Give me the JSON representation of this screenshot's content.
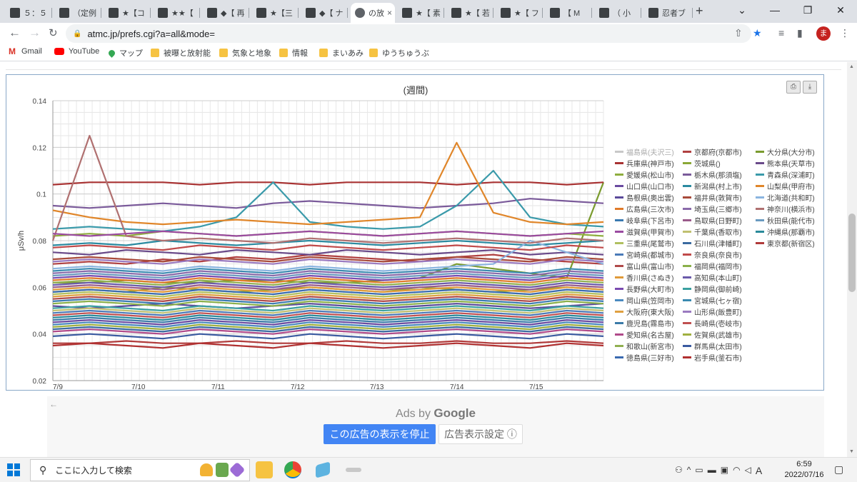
{
  "browser": {
    "tabs": [
      {
        "label": "５：５",
        "active": false
      },
      {
        "label": "（定例",
        "active": false
      },
      {
        "label": "★【コ",
        "active": false
      },
      {
        "label": "★★【",
        "active": false
      },
      {
        "label": "◆【 再",
        "active": false
      },
      {
        "label": "★【三",
        "active": false
      },
      {
        "label": "◆【 ナ",
        "active": false
      },
      {
        "label": "の放",
        "active": true
      },
      {
        "label": "★【 素",
        "active": false
      },
      {
        "label": "★【 若",
        "active": false
      },
      {
        "label": "★【 フ",
        "active": false
      },
      {
        "label": "【 M",
        "active": false
      },
      {
        "label": "（ 小",
        "active": false
      },
      {
        "label": "忍者ブ",
        "active": false
      }
    ],
    "new_tab": "+",
    "url": "atmc.jp/prefs.cgi?a=all&mode=",
    "profile_initial": "ま",
    "window_controls": [
      "⌄",
      "—",
      "❐",
      "✕"
    ]
  },
  "bookmarks": [
    {
      "label": "Gmail",
      "icon": "gmail-icon"
    },
    {
      "label": "YouTube",
      "icon": "youtube-icon"
    },
    {
      "label": "マップ",
      "icon": "maps-icon"
    },
    {
      "label": "被曝と放射能",
      "icon": "folder-icon"
    },
    {
      "label": "気象と地象",
      "icon": "folder-icon"
    },
    {
      "label": "情報",
      "icon": "folder-icon"
    },
    {
      "label": "まいあみ",
      "icon": "folder-icon"
    },
    {
      "label": "ゆうちゅうぶ",
      "icon": "folder-icon"
    }
  ],
  "chart_data": {
    "type": "line",
    "title": "(週間)",
    "ylabel": "μSv/h",
    "xlabel": "",
    "ylim": [
      0.02,
      0.14
    ],
    "yticks": [
      "0.14",
      "0.12",
      "0.1",
      "0.08",
      "0.06",
      "0.04",
      "0.02"
    ],
    "ytick_values": [
      0.14,
      0.12,
      0.1,
      0.08,
      0.06,
      0.04,
      0.02
    ],
    "xticks": [
      "7/9",
      "7/10",
      "7/11",
      "7/12",
      "7/13",
      "7/14",
      "7/15"
    ],
    "grid": true,
    "legend_position": "right",
    "series": [
      {
        "name": "福島県(夫沢三)",
        "color": "#c8c8c8",
        "values": []
      },
      {
        "name": "京都府(京都市)",
        "color": "#b04040",
        "values": [
          0.07,
          0.071,
          0.07,
          0.072,
          0.071,
          0.073,
          0.072,
          0.074,
          0.073,
          0.072,
          0.071,
          0.073,
          0.074,
          0.072,
          0.071,
          0.07
        ]
      },
      {
        "name": "大分県(大分市)",
        "color": "#7a9b2e",
        "values": [
          0.062,
          0.062,
          0.063,
          0.062,
          0.062,
          0.063,
          0.063,
          0.062,
          0.062,
          0.063,
          0.064,
          0.07,
          0.068,
          0.066,
          0.064,
          0.105
        ]
      },
      {
        "name": "兵庫県(神戸市)",
        "color": "#a83232",
        "values": [
          0.104,
          0.105,
          0.105,
          0.105,
          0.104,
          0.105,
          0.105,
          0.104,
          0.105,
          0.105,
          0.105,
          0.104,
          0.105,
          0.105,
          0.104,
          0.105
        ]
      },
      {
        "name": "茨城県()",
        "color": "#8aa836",
        "values": [
          0.058,
          0.059,
          0.058,
          0.06,
          0.059,
          0.058,
          0.059,
          0.06,
          0.059,
          0.058,
          0.06,
          0.059,
          0.058,
          0.059,
          0.06,
          0.059
        ]
      },
      {
        "name": "熊本県(天草市)",
        "color": "#6a4a8a",
        "values": [
          0.075,
          0.074,
          0.076,
          0.075,
          0.074,
          0.076,
          0.075,
          0.074,
          0.076,
          0.075,
          0.074,
          0.075,
          0.076,
          0.074,
          0.075,
          0.074
        ]
      },
      {
        "name": "愛媛県(松山市)",
        "color": "#8fae3e",
        "values": [
          0.082,
          0.083,
          0.082,
          0.084,
          0.083,
          0.082,
          0.083,
          0.084,
          0.083,
          0.082,
          0.083,
          0.084,
          0.083,
          0.082,
          0.083,
          0.082
        ]
      },
      {
        "name": "栃木県(那須塩)",
        "color": "#7a5a9a",
        "values": [
          0.095,
          0.094,
          0.095,
          0.096,
          0.095,
          0.094,
          0.096,
          0.097,
          0.096,
          0.095,
          0.094,
          0.095,
          0.096,
          0.098,
          0.097,
          0.096
        ]
      },
      {
        "name": "青森県(深浦町)",
        "color": "#3a9aaa",
        "values": [
          0.085,
          0.086,
          0.085,
          0.084,
          0.086,
          0.09,
          0.105,
          0.088,
          0.086,
          0.085,
          0.086,
          0.095,
          0.11,
          0.09,
          0.087,
          0.086
        ]
      },
      {
        "name": "山口県(山口市)",
        "color": "#6a4aa0",
        "values": [
          0.045,
          0.046,
          0.045,
          0.044,
          0.046,
          0.045,
          0.044,
          0.046,
          0.045,
          0.044,
          0.045,
          0.046,
          0.045,
          0.044,
          0.046,
          0.045
        ]
      },
      {
        "name": "新潟県(村上市)",
        "color": "#2a8aa0",
        "values": [
          0.078,
          0.079,
          0.078,
          0.08,
          0.079,
          0.078,
          0.079,
          0.08,
          0.079,
          0.078,
          0.079,
          0.08,
          0.079,
          0.078,
          0.079,
          0.08
        ]
      },
      {
        "name": "山梨県(甲府市)",
        "color": "#e0862a",
        "values": [
          0.093,
          0.09,
          0.088,
          0.087,
          0.088,
          0.089,
          0.088,
          0.087,
          0.088,
          0.089,
          0.09,
          0.122,
          0.092,
          0.088,
          0.087,
          0.088
        ]
      },
      {
        "name": "島根県(奥出雲)",
        "color": "#5a4a9a",
        "values": [
          0.052,
          0.051,
          0.052,
          0.053,
          0.052,
          0.051,
          0.052,
          0.053,
          0.052,
          0.051,
          0.052,
          0.053,
          0.052,
          0.051,
          0.052,
          0.053
        ]
      },
      {
        "name": "福井県(敦賀市)",
        "color": "#a84a3a",
        "values": [
          0.072,
          0.073,
          0.072,
          0.071,
          0.073,
          0.072,
          0.071,
          0.073,
          0.072,
          0.071,
          0.072,
          0.073,
          0.072,
          0.071,
          0.073,
          0.072
        ]
      },
      {
        "name": "北海道(共和町)",
        "color": "#8ab4e0",
        "values": [
          0.068,
          0.069,
          0.068,
          0.067,
          0.069,
          0.068,
          0.067,
          0.069,
          0.068,
          0.067,
          0.068,
          0.069,
          0.07,
          0.08,
          0.075,
          0.07
        ]
      },
      {
        "name": "広島県(三次市)",
        "color": "#e07a2a",
        "values": [
          0.063,
          0.064,
          0.063,
          0.062,
          0.064,
          0.063,
          0.062,
          0.064,
          0.063,
          0.062,
          0.063,
          0.064,
          0.063,
          0.062,
          0.064,
          0.063
        ]
      },
      {
        "name": "埼玉県(三郷市)",
        "color": "#8a6aaa",
        "values": [
          0.066,
          0.067,
          0.066,
          0.065,
          0.067,
          0.066,
          0.065,
          0.067,
          0.066,
          0.065,
          0.066,
          0.067,
          0.066,
          0.065,
          0.067,
          0.066
        ]
      },
      {
        "name": "神奈川(横浜市)",
        "color": "#b07070",
        "values": [
          0.08,
          0.125,
          0.082,
          0.08,
          0.081,
          0.08,
          0.079,
          0.081,
          0.08,
          0.079,
          0.08,
          0.081,
          0.08,
          0.079,
          0.081,
          0.08
        ]
      },
      {
        "name": "岐阜県(下呂市)",
        "color": "#3a7ab0",
        "values": [
          0.054,
          0.055,
          0.054,
          0.053,
          0.055,
          0.054,
          0.053,
          0.055,
          0.054,
          0.053,
          0.054,
          0.055,
          0.054,
          0.053,
          0.055,
          0.054
        ]
      },
      {
        "name": "鳥取県(日野町)",
        "color": "#9a5a8a",
        "values": [
          0.06,
          0.061,
          0.06,
          0.059,
          0.061,
          0.06,
          0.059,
          0.061,
          0.06,
          0.059,
          0.06,
          0.061,
          0.06,
          0.059,
          0.061,
          0.06
        ]
      },
      {
        "name": "秋田県(能代市)",
        "color": "#6a9ac0",
        "values": [
          0.065,
          0.066,
          0.065,
          0.064,
          0.066,
          0.065,
          0.064,
          0.066,
          0.065,
          0.064,
          0.065,
          0.066,
          0.065,
          0.064,
          0.066,
          0.065
        ]
      },
      {
        "name": "滋賀県(甲賀市)",
        "color": "#9a4aa0",
        "values": [
          0.083,
          0.082,
          0.083,
          0.084,
          0.083,
          0.082,
          0.083,
          0.084,
          0.083,
          0.082,
          0.083,
          0.084,
          0.083,
          0.082,
          0.083,
          0.084
        ]
      },
      {
        "name": "千葉県(香取市)",
        "color": "#c0c070",
        "values": [
          0.05,
          0.051,
          0.05,
          0.049,
          0.051,
          0.05,
          0.049,
          0.051,
          0.05,
          0.049,
          0.05,
          0.051,
          0.05,
          0.049,
          0.051,
          0.05
        ]
      },
      {
        "name": "沖縄県(那覇市)",
        "color": "#2a8a9a",
        "values": [
          0.047,
          0.048,
          0.047,
          0.046,
          0.048,
          0.047,
          0.046,
          0.048,
          0.047,
          0.046,
          0.047,
          0.048,
          0.047,
          0.046,
          0.048,
          0.047
        ]
      },
      {
        "name": "三重県(尾鷲市)",
        "color": "#b0c060",
        "values": [
          0.057,
          0.058,
          0.057,
          0.056,
          0.058,
          0.057,
          0.056,
          0.058,
          0.057,
          0.056,
          0.057,
          0.058,
          0.057,
          0.056,
          0.058,
          0.057
        ]
      },
      {
        "name": "石川県(津幡町)",
        "color": "#3a6aa0",
        "values": [
          0.042,
          0.043,
          0.042,
          0.041,
          0.043,
          0.042,
          0.041,
          0.043,
          0.042,
          0.041,
          0.042,
          0.043,
          0.042,
          0.041,
          0.043,
          0.042
        ]
      },
      {
        "name": "東京都(新宿区)",
        "color": "#b03a3a",
        "values": [
          0.036,
          0.036,
          0.037,
          0.036,
          0.036,
          0.037,
          0.036,
          0.036,
          0.037,
          0.036,
          0.036,
          0.037,
          0.036,
          0.036,
          0.037,
          0.036
        ]
      },
      {
        "name": "宮崎県(都城市)",
        "color": "#4a7ab8",
        "values": [
          0.049,
          0.05,
          0.049,
          0.048,
          0.05,
          0.049,
          0.048,
          0.05,
          0.049,
          0.048,
          0.049,
          0.05,
          0.049,
          0.048,
          0.05,
          0.049
        ]
      },
      {
        "name": "奈良県(奈良市)",
        "color": "#c04a4a",
        "values": [
          0.077,
          0.078,
          0.077,
          0.076,
          0.078,
          0.077,
          0.076,
          0.078,
          0.077,
          0.076,
          0.077,
          0.078,
          0.077,
          0.076,
          0.078,
          0.077
        ]
      },
      {
        "name": "富山県(富山市)",
        "color": "#b04a4a",
        "values": [
          0.055,
          0.056,
          0.055,
          0.054,
          0.056,
          0.055,
          0.054,
          0.056,
          0.055,
          0.054,
          0.055,
          0.056,
          0.055,
          0.054,
          0.056,
          0.055
        ]
      },
      {
        "name": "福岡県(福岡市)",
        "color": "#8ab04a",
        "values": [
          0.053,
          0.054,
          0.053,
          0.052,
          0.054,
          0.053,
          0.052,
          0.054,
          0.053,
          0.052,
          0.053,
          0.054,
          0.053,
          0.052,
          0.054,
          0.053
        ]
      },
      {
        "name": "香川県(さぬき)",
        "color": "#e09a3a",
        "values": [
          0.059,
          0.06,
          0.059,
          0.058,
          0.06,
          0.059,
          0.058,
          0.06,
          0.059,
          0.058,
          0.059,
          0.06,
          0.059,
          0.058,
          0.06,
          0.059
        ]
      },
      {
        "name": "高知県(本山町)",
        "color": "#6a5aaa",
        "values": [
          0.061,
          0.062,
          0.061,
          0.06,
          0.062,
          0.061,
          0.06,
          0.062,
          0.061,
          0.06,
          0.061,
          0.062,
          0.061,
          0.06,
          0.062,
          0.061
        ]
      },
      {
        "name": "長野県(大町市)",
        "color": "#7a4ab0",
        "values": [
          0.064,
          0.065,
          0.064,
          0.063,
          0.065,
          0.064,
          0.063,
          0.065,
          0.064,
          0.063,
          0.064,
          0.065,
          0.064,
          0.063,
          0.065,
          0.064
        ]
      },
      {
        "name": "静岡県(御前崎)",
        "color": "#3aa0a0",
        "values": [
          0.051,
          0.052,
          0.051,
          0.05,
          0.052,
          0.051,
          0.05,
          0.052,
          0.051,
          0.05,
          0.051,
          0.052,
          0.051,
          0.05,
          0.052,
          0.051
        ]
      },
      {
        "name": "岡山県(笠岡市)",
        "color": "#4a8ac0",
        "values": [
          0.044,
          0.045,
          0.044,
          0.043,
          0.045,
          0.044,
          0.043,
          0.045,
          0.044,
          0.043,
          0.044,
          0.045,
          0.044,
          0.043,
          0.045,
          0.044
        ]
      },
      {
        "name": "宮城県(七ヶ宿)",
        "color": "#3a8ab0",
        "values": [
          0.067,
          0.068,
          0.067,
          0.066,
          0.068,
          0.067,
          0.066,
          0.068,
          0.067,
          0.066,
          0.067,
          0.068,
          0.067,
          0.066,
          0.068,
          0.067
        ]
      },
      {
        "name": "大阪府(東大阪)",
        "color": "#e0a040",
        "values": [
          0.056,
          0.057,
          0.056,
          0.055,
          0.057,
          0.056,
          0.055,
          0.057,
          0.056,
          0.055,
          0.056,
          0.057,
          0.056,
          0.055,
          0.057,
          0.056
        ]
      },
      {
        "name": "山形県(飯豊町)",
        "color": "#9a7ac0",
        "values": [
          0.071,
          0.072,
          0.071,
          0.07,
          0.072,
          0.071,
          0.07,
          0.072,
          0.071,
          0.07,
          0.071,
          0.072,
          0.071,
          0.07,
          0.072,
          0.071
        ]
      },
      {
        "name": "鹿児島(霧島市)",
        "color": "#3a7aa8",
        "values": [
          0.046,
          0.047,
          0.046,
          0.045,
          0.047,
          0.046,
          0.045,
          0.047,
          0.046,
          0.045,
          0.046,
          0.047,
          0.046,
          0.045,
          0.047,
          0.046
        ]
      },
      {
        "name": "長崎県(壱岐市)",
        "color": "#c05050",
        "values": [
          0.048,
          0.049,
          0.048,
          0.047,
          0.049,
          0.048,
          0.047,
          0.049,
          0.048,
          0.047,
          0.048,
          0.049,
          0.048,
          0.047,
          0.049,
          0.048
        ]
      },
      {
        "name": "愛知県(名古屋)",
        "color": "#b04a8a",
        "values": [
          0.041,
          0.042,
          0.041,
          0.04,
          0.042,
          0.041,
          0.04,
          0.042,
          0.041,
          0.04,
          0.041,
          0.042,
          0.041,
          0.04,
          0.042,
          0.041
        ]
      },
      {
        "name": "佐賀県(武雄市)",
        "color": "#a0b040",
        "values": [
          0.043,
          0.044,
          0.043,
          0.042,
          0.044,
          0.043,
          0.042,
          0.044,
          0.043,
          0.042,
          0.043,
          0.044,
          0.043,
          0.042,
          0.044,
          0.043
        ]
      },
      {
        "name": "和歌山(新宮市)",
        "color": "#90b050",
        "values": [
          0.062,
          0.063,
          0.062,
          0.061,
          0.063,
          0.062,
          0.061,
          0.063,
          0.062,
          0.061,
          0.062,
          0.063,
          0.062,
          0.061,
          0.063,
          0.062
        ]
      },
      {
        "name": "群馬県(太田市)",
        "color": "#3a5aa0",
        "values": [
          0.039,
          0.04,
          0.039,
          0.038,
          0.04,
          0.039,
          0.038,
          0.04,
          0.039,
          0.038,
          0.039,
          0.04,
          0.039,
          0.038,
          0.04,
          0.039
        ]
      },
      {
        "name": "徳島県(三好市)",
        "color": "#3a6ab0",
        "values": [
          0.058,
          0.059,
          0.058,
          0.057,
          0.059,
          0.058,
          0.057,
          0.059,
          0.058,
          0.057,
          0.058,
          0.059,
          0.058,
          0.057,
          0.059,
          0.058
        ]
      },
      {
        "name": "岩手県(釜石市)",
        "color": "#b03030",
        "values": [
          0.035,
          0.036,
          0.035,
          0.034,
          0.036,
          0.035,
          0.034,
          0.036,
          0.035,
          0.034,
          0.035,
          0.036,
          0.035,
          0.034,
          0.036,
          0.035
        ]
      }
    ]
  },
  "ads": {
    "back": "←",
    "ads_by": "Ads by",
    "google": "Google",
    "stop_button": "この広告の表示を停止",
    "settings_button": "広告表示設定 ⓘ"
  },
  "taskbar": {
    "search_placeholder": "ここに入力して検索",
    "time": "6:59",
    "date": "2022/07/16",
    "ime": "A"
  }
}
